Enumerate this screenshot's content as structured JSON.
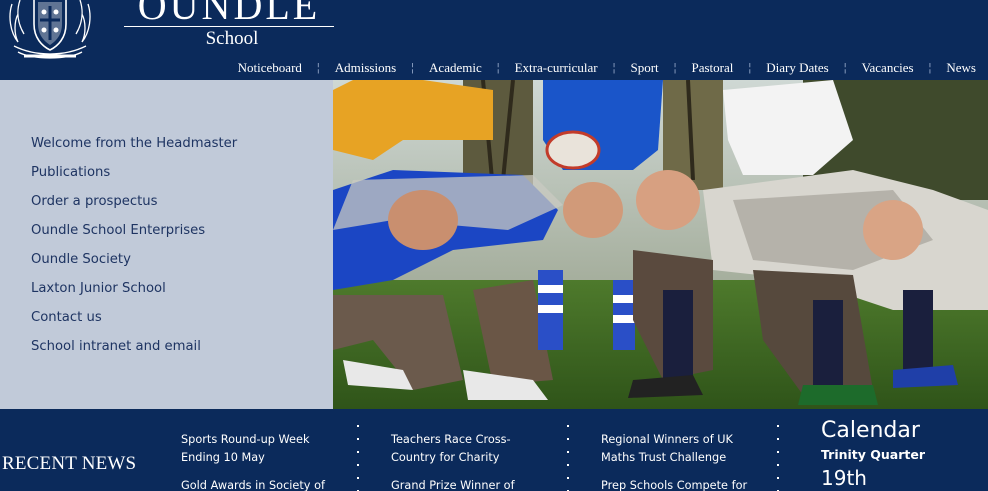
{
  "header": {
    "school_name": "OUNDLE",
    "school_subtitle": "School"
  },
  "nav": {
    "items": [
      {
        "label": "Noticeboard"
      },
      {
        "label": "Admissions"
      },
      {
        "label": "Academic"
      },
      {
        "label": "Extra-curricular"
      },
      {
        "label": "Sport"
      },
      {
        "label": "Pastoral"
      },
      {
        "label": "Diary Dates"
      },
      {
        "label": "Vacancies"
      },
      {
        "label": "News"
      }
    ],
    "separator": "¦"
  },
  "sidebar": {
    "items": [
      {
        "label": "Welcome from the Headmaster"
      },
      {
        "label": "Publications"
      },
      {
        "label": "Order a prospectus"
      },
      {
        "label": "Oundle School Enterprises"
      },
      {
        "label": "Oundle Society"
      },
      {
        "label": "Laxton Junior School"
      },
      {
        "label": "Contact us"
      },
      {
        "label": "School intranet and email"
      }
    ]
  },
  "hero": {
    "subject": "rugby scrum photo"
  },
  "recent_news": {
    "heading": "RECENT NEWS",
    "columns": [
      {
        "items": [
          "Sports Round-up Week Ending 10 May",
          "Gold Awards in Society of"
        ]
      },
      {
        "items": [
          "Teachers Race Cross-Country for Charity",
          "Grand Prize Winner of"
        ]
      },
      {
        "items": [
          "Regional Winners of UK Maths Trust Challenge",
          "Prep Schools Compete for"
        ]
      }
    ]
  },
  "calendar": {
    "title": "Calendar",
    "term": "Trinity Quarter",
    "day": "19th"
  },
  "colors": {
    "navy": "#0b2a5b",
    "sidebar_bg": "#c1cad9",
    "sidebar_text": "#1e3462",
    "white": "#ffffff"
  }
}
